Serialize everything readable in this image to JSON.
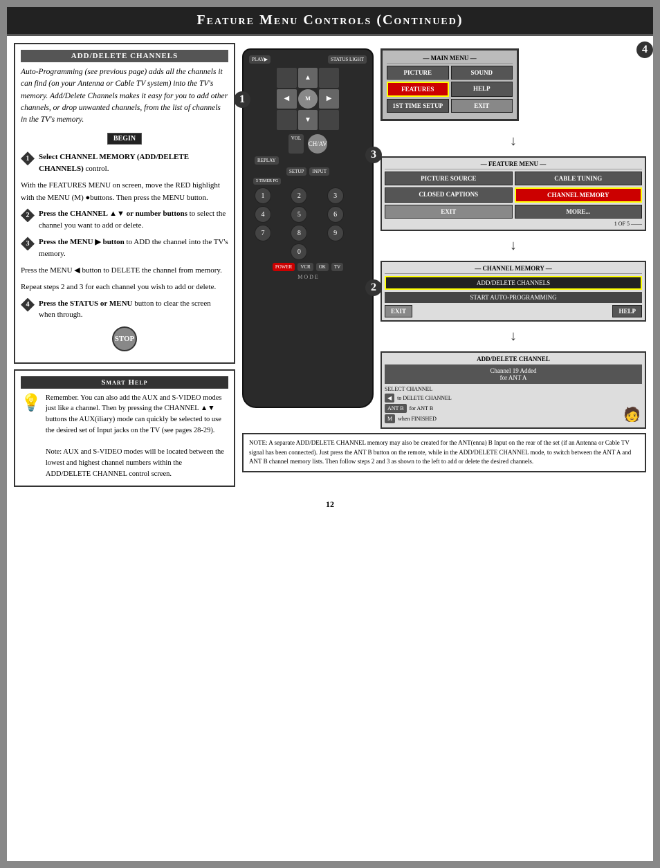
{
  "header": {
    "title": "Feature Menu Controls (Continued)"
  },
  "left": {
    "add_delete_title": "ADD/DELETE CHANNELS",
    "intro": "Auto-Programming (see previous page) adds all the channels it can find (on your Antenna or Cable TV system) into the TV's memory. Add/Delete Channels makes it easy for you to add other channels, or drop unwanted channels, from the list of channels in the TV's memory.",
    "begin_label": "BEGIN",
    "steps": [
      {
        "number": "1",
        "main": "Select CHANNEL MEMORY (ADD/DELETE CHANNELS) control.",
        "sub": "With the FEATURES MENU on screen, move the RED highlight with the MENU (M) buttons. Then press the MENU button."
      },
      {
        "number": "2",
        "main": "Press the CHANNEL ▲▼ or number buttons to select the channel you want to add or delete."
      },
      {
        "number": "3",
        "main": "Press the MENU ▶ button to ADD the channel into the TV's memory.",
        "sub1": "Press the MENU ◀ button to DELETE the channel from memory.",
        "sub2": "Repeat steps 2 and 3 for each channel you wish to add or delete."
      },
      {
        "number": "4",
        "main": "Press the STATUS or MENU button to clear the screen when through."
      }
    ],
    "stop_label": "STOP",
    "smart_help_title": "Smart Help",
    "smart_help_text": "Remember. You can also add the AUX and S-VIDEO modes just like a channel. Then by pressing the CHANNEL ▲▼ buttons the AUX(iliary) mode can quickly be selected to use the desired set of Input jacks on the TV (see pages 28-29).\n\nNote: AUX and S-VIDEO modes will be located between the lowest and highest channel numbers within the ADD/DELETE CHANNEL control screen."
  },
  "menus": {
    "main_menu": {
      "label": "MAIN MENU",
      "items": [
        "PICTURE",
        "SOUND",
        "FEATURES",
        "HELP",
        "1ST TIME SETUP",
        "EXIT"
      ]
    },
    "feature_menu": {
      "label": "FEATURE MENU",
      "items": [
        "PICTURE SOURCE",
        "CABLE TUNING",
        "CLOSED CAPTIONS",
        "CHANNEL MEMORY",
        "EXIT",
        "MORE..."
      ],
      "page": "1 OF 5"
    },
    "channel_memory": {
      "label": "CHANNEL MEMORY",
      "items": [
        "ADD/DELETE CHANNELS",
        "START AUTO-PROGRAMMING"
      ],
      "footer": [
        "EXIT",
        "HELP"
      ]
    },
    "add_delete": {
      "label": "ADD/DELETE CHANNEL",
      "channel_added": "Channel 19 Added for ANT A",
      "select_channel": "SELECT CHANNEL",
      "rows": [
        {
          "btn": "◀",
          "text": "to DELETE CHANNEL"
        },
        {
          "btn": "▶",
          "text": "for ANT B"
        },
        {
          "btn": "M",
          "text": "when FINISHED"
        }
      ]
    }
  },
  "note": "NOTE: A separate ADD/DELETE CHANNEL memory may also be created for the ANT(enna) B Input on the rear of the set (if an Antenna or Cable TV signal has been connected). Just press the ANT B button on the remote, while in the ADD/DELETE CHANNEL mode, to switch between the ANT A and ANT B channel memory lists. Then follow steps 2 and 3 as shown to the left to add or delete the desired channels.",
  "page_number": "12"
}
